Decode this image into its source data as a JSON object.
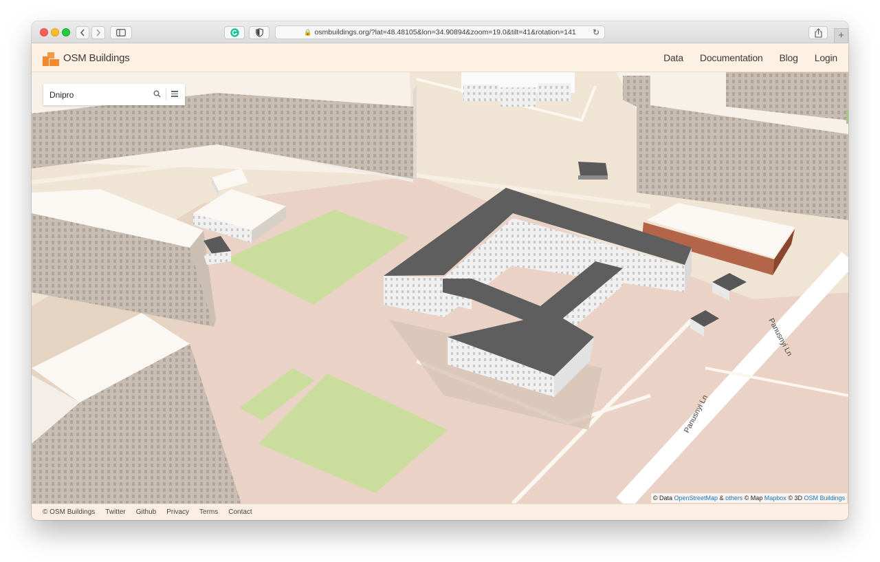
{
  "browser": {
    "url": "osmbuildings.org/?lat=48.48105&lon=34.90894&zoom=19.0&tilt=41&rotation=141"
  },
  "header": {
    "logo_text": "OSM Buildings",
    "nav": [
      "Data",
      "Documentation",
      "Blog",
      "Login"
    ]
  },
  "search": {
    "value": "Dnipro"
  },
  "map": {
    "street_label_1": "Panusnyi Ln",
    "street_label_2": "Panusnyi Ln"
  },
  "attribution": {
    "prefix": "© Data",
    "osm": "OpenStreetMap",
    "amp": "&",
    "others": "others",
    "map_text": "© Map",
    "mapbox": "Mapbox",
    "three_d": "© 3D",
    "osmb": "OSM Buildings"
  },
  "footer": {
    "copyright": "© OSM Buildings",
    "links": [
      "Twitter",
      "Github",
      "Privacy",
      "Terms",
      "Contact"
    ]
  },
  "colors": {
    "accent": "#ef8a2d",
    "link": "#1b75bb",
    "map_ground": "#efe4d4",
    "park": "#cadd9d",
    "roof_dark": "#5e5e5e"
  }
}
